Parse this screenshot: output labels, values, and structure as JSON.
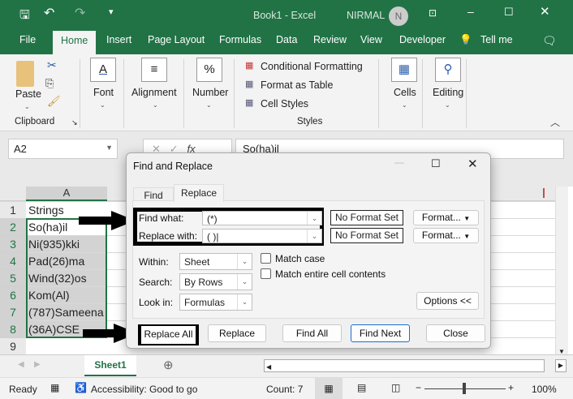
{
  "titlebar": {
    "title": "Book1  -  Excel",
    "user": "NIRMAL",
    "avatar_initial": "N"
  },
  "tabs": [
    "File",
    "Home",
    "Insert",
    "Page Layout",
    "Formulas",
    "Data",
    "Review",
    "View",
    "Developer",
    "Tell me"
  ],
  "ribbon": {
    "paste": "Paste",
    "clipboard": "Clipboard",
    "font": "Font",
    "alignment": "Alignment",
    "number": "Number",
    "conditional_formatting": "Conditional Formatting",
    "format_as_table": "Format as Table",
    "cell_styles": "Cell Styles",
    "styles": "Styles",
    "cells": "Cells",
    "editing": "Editing"
  },
  "formula_bar": {
    "name_box": "A2",
    "fx": "fx",
    "content": "So(ha)il"
  },
  "sheet": {
    "column": "A",
    "rows": [
      "1",
      "2",
      "3",
      "4",
      "5",
      "6",
      "7",
      "8",
      "9"
    ],
    "cells": [
      "Strings",
      "So(ha)il",
      "Ni(935)kki",
      "Pad(26)ma",
      "Wind(32)os",
      "Kom(Al)",
      "(787)Sameena",
      "(36A)CSE",
      ""
    ]
  },
  "dialog": {
    "title": "Find and Replace",
    "tab_find": "Find",
    "tab_replace": "Replace",
    "find_what_label": "Find what:",
    "find_what_value": "(*)",
    "replace_with_label": "Replace with:",
    "replace_with_value": "( )",
    "no_format_1": "No Format Set",
    "no_format_2": "No Format Set",
    "format_1": "Format...",
    "format_2": "Format...",
    "within_label": "Within:",
    "within_value": "Sheet",
    "search_label": "Search:",
    "search_value": "By Rows",
    "lookin_label": "Look in:",
    "lookin_value": "Formulas",
    "match_case": "Match case",
    "match_entire": "Match entire cell contents",
    "options": "Options <<",
    "replace_all": "Replace All",
    "replace": "Replace",
    "find_all": "Find All",
    "find_next": "Find Next",
    "close": "Close"
  },
  "sheet_tab": "Sheet1",
  "status": {
    "ready": "Ready",
    "accessibility": "Accessibility: Good to go",
    "count": "Count: 7",
    "zoom": "100%"
  }
}
